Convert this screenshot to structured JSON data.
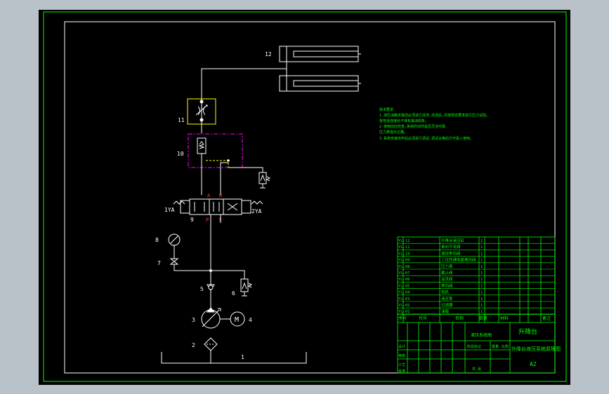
{
  "colors": {
    "background": "#000000",
    "frame": "#ffffff",
    "outer_frame": "#00ff00",
    "window_bg": "#b9c1c9",
    "annotation": "#00ff00",
    "valve_box_11": "#ffff00",
    "valve_box_10": "#ff00ff",
    "port_label": "#ff3030",
    "pilot_line": "#ffff00",
    "title_block": "#00ff00"
  },
  "components": {
    "label_1": "1",
    "label_2": "2",
    "label_3": "3",
    "label_4": "4",
    "label_5": "5",
    "label_6": "6",
    "label_7": "7",
    "label_8": "8",
    "label_9": "9",
    "label_10": "10",
    "label_11": "11",
    "label_12": "12",
    "motor": "M",
    "solenoid_left": "1YA",
    "solenoid_right": "2YA",
    "port_a": "A",
    "port_b": "B",
    "port_p": "P",
    "port_t": "T"
  },
  "notes": {
    "title": "技术要求",
    "line1": "1.液压油路安装前必须进行清洗,清洗后,并按规定要求进行压力试验。",
    "line2": "各管道连接处不得有漏油现象。",
    "line3": "2.使用前应检查,各阀件动作是否灵活可靠",
    "line4": "压力表指示正确。",
    "line5": "3.系统安装完毕后必须进行调试,调试合格后方可投入使用。"
  },
  "bom": [
    {
      "code": "YL-12",
      "name": "升降台液压缸",
      "qty": "2"
    },
    {
      "code": "YL-11",
      "name": "单向节流阀",
      "qty": "1"
    },
    {
      "code": "YL-10",
      "name": "液控单向阀",
      "qty": "1"
    },
    {
      "code": "YL-09",
      "name": "三位四通电磁换向阀",
      "qty": "1"
    },
    {
      "code": "YL-08",
      "name": "压力表",
      "qty": "1"
    },
    {
      "code": "YL-07",
      "name": "截止阀",
      "qty": "1"
    },
    {
      "code": "YL-06",
      "name": "溢流阀",
      "qty": "1"
    },
    {
      "code": "YL-05",
      "name": "单向阀",
      "qty": "1"
    },
    {
      "code": "YL-04",
      "name": "电机",
      "qty": "1"
    },
    {
      "code": "YL-03",
      "name": "液压泵",
      "qty": "1"
    },
    {
      "code": "YL-02",
      "name": "过滤器",
      "qty": "1"
    },
    {
      "code": "YL-01",
      "name": "油箱",
      "qty": "1"
    }
  ],
  "title_block": {
    "header_no": "序号",
    "header_code": "代号",
    "header_name": "名称",
    "header_qty": "数量",
    "header_material": "材料",
    "header_note": "备注",
    "company": "升降台",
    "drawing_name": "升降台液压系统原理图",
    "system_label": "液压系统图",
    "stage": "阶段标记",
    "weight": "重量",
    "scale": "比例",
    "sheet": "共 张",
    "size": "A2",
    "designer": "设计",
    "checker": "审核",
    "process": "工艺",
    "approve": "批准"
  }
}
